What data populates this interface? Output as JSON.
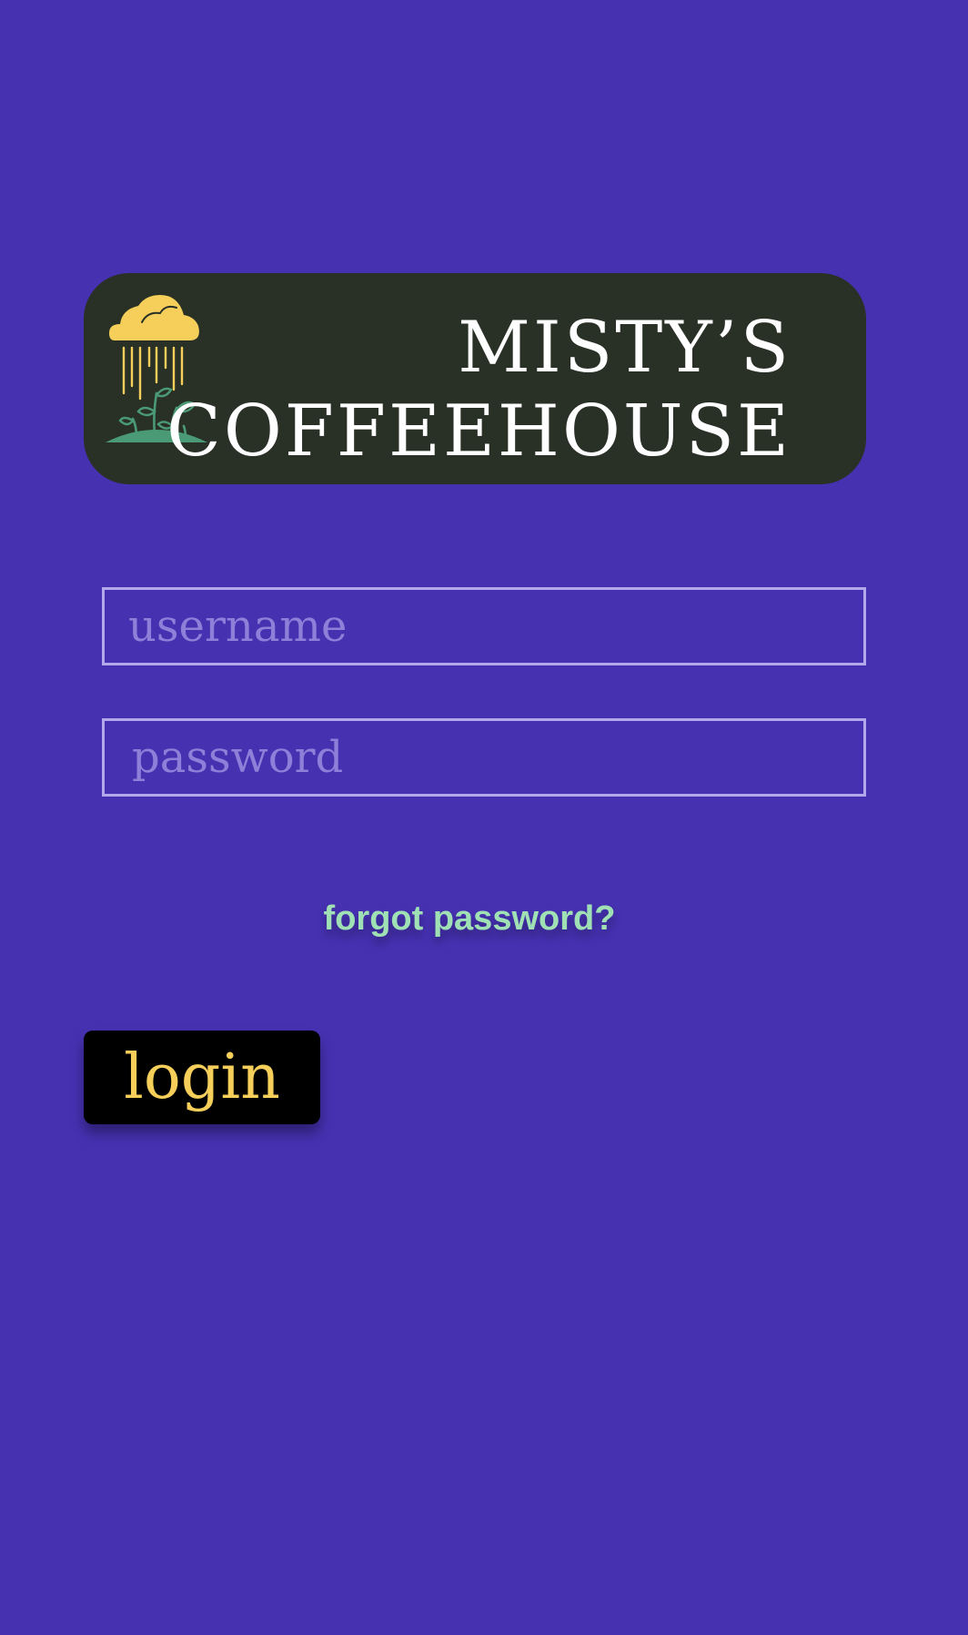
{
  "brand": {
    "line1": "MISTY’S",
    "line2": "COFFEEHOUSE",
    "icon": "rain-cloud-sprout-icon"
  },
  "form": {
    "username_placeholder": "username",
    "password_placeholder": "password",
    "forgot_label": "forgot password?",
    "login_label": "login"
  },
  "colors": {
    "background": "#4631b1",
    "banner": "#293127",
    "cloud": "#f5cf5a",
    "leaf": "#4a9a76",
    "link": "#9fe0b4",
    "button": "#000000",
    "button_text": "#f5cf5a",
    "field_border": "#b3a8ec"
  }
}
